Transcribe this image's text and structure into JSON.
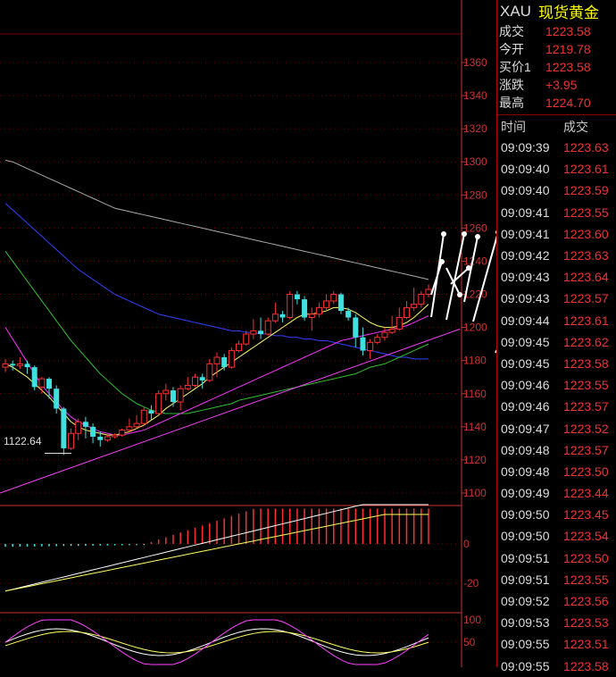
{
  "header": {
    "symbol": "XAU",
    "name": "现货黄金"
  },
  "quote": [
    {
      "label": "成交",
      "value": "1223.58"
    },
    {
      "label": "今开",
      "value": "1219.78"
    },
    {
      "label": "买价1",
      "value": "1223.58"
    },
    {
      "label": "涨跌",
      "value": "+3.95"
    },
    {
      "label": "最高",
      "value": "1224.70"
    }
  ],
  "ticks_header": {
    "time": "时间",
    "price": "成交"
  },
  "ticks": [
    {
      "time": "09:09:39",
      "price": "1223.63"
    },
    {
      "time": "09:09:40",
      "price": "1223.61"
    },
    {
      "time": "09:09:40",
      "price": "1223.59"
    },
    {
      "time": "09:09:41",
      "price": "1223.55"
    },
    {
      "time": "09:09:41",
      "price": "1223.60"
    },
    {
      "time": "09:09:42",
      "price": "1223.63"
    },
    {
      "time": "09:09:43",
      "price": "1223.64"
    },
    {
      "time": "09:09:43",
      "price": "1223.57"
    },
    {
      "time": "09:09:44",
      "price": "1223.61"
    },
    {
      "time": "09:09:45",
      "price": "1223.62"
    },
    {
      "time": "09:09:45",
      "price": "1223.58"
    },
    {
      "time": "09:09:46",
      "price": "1223.55"
    },
    {
      "time": "09:09:46",
      "price": "1223.57"
    },
    {
      "time": "09:09:47",
      "price": "1223.52"
    },
    {
      "time": "09:09:48",
      "price": "1223.57"
    },
    {
      "time": "09:09:48",
      "price": "1223.50"
    },
    {
      "time": "09:09:49",
      "price": "1223.44"
    },
    {
      "time": "09:09:50",
      "price": "1223.45"
    },
    {
      "time": "09:09:50",
      "price": "1223.54"
    },
    {
      "time": "09:09:51",
      "price": "1223.50"
    },
    {
      "time": "09:09:51",
      "price": "1223.55"
    },
    {
      "time": "09:09:52",
      "price": "1223.56"
    },
    {
      "time": "09:09:53",
      "price": "1223.53"
    },
    {
      "time": "09:09:55",
      "price": "1223.51"
    },
    {
      "time": "09:09:55",
      "price": "1223.58"
    }
  ],
  "colors": {
    "up": "#ff3030",
    "down": "#40e0e0",
    "grid": "#7a0000",
    "axis": "#c33333"
  },
  "chart_data": {
    "type": "candlestick",
    "price_axis": {
      "ticks": [
        1360,
        1340,
        1320,
        1300,
        1280,
        1260,
        1240,
        1220,
        1200,
        1180,
        1160,
        1140,
        1120,
        1100
      ]
    },
    "low_label": "1122.64",
    "macd_axis": {
      "ticks": [
        "0",
        "-20"
      ]
    },
    "kdj_axis": {
      "ticks": [
        "100",
        "50"
      ]
    },
    "candles": [
      {
        "o": 1176,
        "c": 1178,
        "h": 1181,
        "l": 1173
      },
      {
        "o": 1178,
        "c": 1177,
        "h": 1180,
        "l": 1174
      },
      {
        "o": 1177,
        "c": 1178,
        "h": 1182,
        "l": 1175
      },
      {
        "o": 1178,
        "c": 1176,
        "h": 1180,
        "l": 1172
      },
      {
        "o": 1176,
        "c": 1164,
        "h": 1177,
        "l": 1162
      },
      {
        "o": 1164,
        "c": 1169,
        "h": 1170,
        "l": 1160
      },
      {
        "o": 1169,
        "c": 1163,
        "h": 1170,
        "l": 1157
      },
      {
        "o": 1163,
        "c": 1151,
        "h": 1165,
        "l": 1148
      },
      {
        "o": 1151,
        "c": 1127,
        "h": 1152,
        "l": 1123
      },
      {
        "o": 1127,
        "c": 1136,
        "h": 1139,
        "l": 1126
      },
      {
        "o": 1136,
        "c": 1143,
        "h": 1145,
        "l": 1132
      },
      {
        "o": 1143,
        "c": 1140,
        "h": 1146,
        "l": 1133
      },
      {
        "o": 1140,
        "c": 1134,
        "h": 1142,
        "l": 1130
      },
      {
        "o": 1134,
        "c": 1132,
        "h": 1137,
        "l": 1128
      },
      {
        "o": 1132,
        "c": 1134,
        "h": 1135,
        "l": 1131
      },
      {
        "o": 1134,
        "c": 1135,
        "h": 1136,
        "l": 1133
      },
      {
        "o": 1135,
        "c": 1138,
        "h": 1139,
        "l": 1134
      },
      {
        "o": 1138,
        "c": 1140,
        "h": 1145,
        "l": 1137
      },
      {
        "o": 1140,
        "c": 1142,
        "h": 1147,
        "l": 1139
      },
      {
        "o": 1142,
        "c": 1150,
        "h": 1152,
        "l": 1141
      },
      {
        "o": 1150,
        "c": 1148,
        "h": 1153,
        "l": 1144
      },
      {
        "o": 1148,
        "c": 1160,
        "h": 1162,
        "l": 1147
      },
      {
        "o": 1160,
        "c": 1162,
        "h": 1166,
        "l": 1156
      },
      {
        "o": 1162,
        "c": 1155,
        "h": 1164,
        "l": 1152
      },
      {
        "o": 1155,
        "c": 1163,
        "h": 1165,
        "l": 1150
      },
      {
        "o": 1163,
        "c": 1165,
        "h": 1170,
        "l": 1162
      },
      {
        "o": 1165,
        "c": 1170,
        "h": 1172,
        "l": 1164
      },
      {
        "o": 1170,
        "c": 1168,
        "h": 1172,
        "l": 1163
      },
      {
        "o": 1168,
        "c": 1178,
        "h": 1181,
        "l": 1167
      },
      {
        "o": 1178,
        "c": 1182,
        "h": 1185,
        "l": 1170
      },
      {
        "o": 1182,
        "c": 1176,
        "h": 1184,
        "l": 1174
      },
      {
        "o": 1176,
        "c": 1186,
        "h": 1188,
        "l": 1175
      },
      {
        "o": 1186,
        "c": 1190,
        "h": 1192,
        "l": 1185
      },
      {
        "o": 1190,
        "c": 1196,
        "h": 1198,
        "l": 1189
      },
      {
        "o": 1196,
        "c": 1198,
        "h": 1205,
        "l": 1193
      },
      {
        "o": 1198,
        "c": 1196,
        "h": 1206,
        "l": 1193
      },
      {
        "o": 1196,
        "c": 1204,
        "h": 1206,
        "l": 1195
      },
      {
        "o": 1204,
        "c": 1208,
        "h": 1215,
        "l": 1203
      },
      {
        "o": 1208,
        "c": 1206,
        "h": 1210,
        "l": 1203
      },
      {
        "o": 1206,
        "c": 1220,
        "h": 1222,
        "l": 1205
      },
      {
        "o": 1220,
        "c": 1217,
        "h": 1222,
        "l": 1214
      },
      {
        "o": 1217,
        "c": 1206,
        "h": 1219,
        "l": 1204
      },
      {
        "o": 1206,
        "c": 1208,
        "h": 1212,
        "l": 1198
      },
      {
        "o": 1208,
        "c": 1212,
        "h": 1215,
        "l": 1206
      },
      {
        "o": 1212,
        "c": 1216,
        "h": 1220,
        "l": 1210
      },
      {
        "o": 1216,
        "c": 1220,
        "h": 1222,
        "l": 1214
      },
      {
        "o": 1220,
        "c": 1210,
        "h": 1221,
        "l": 1208
      },
      {
        "o": 1210,
        "c": 1206,
        "h": 1212,
        "l": 1204
      },
      {
        "o": 1206,
        "c": 1194,
        "h": 1208,
        "l": 1188
      },
      {
        "o": 1194,
        "c": 1186,
        "h": 1200,
        "l": 1183
      },
      {
        "o": 1186,
        "c": 1191,
        "h": 1193,
        "l": 1181
      },
      {
        "o": 1191,
        "c": 1194,
        "h": 1196,
        "l": 1190
      },
      {
        "o": 1194,
        "c": 1197,
        "h": 1200,
        "l": 1192
      },
      {
        "o": 1197,
        "c": 1199,
        "h": 1207,
        "l": 1196
      },
      {
        "o": 1199,
        "c": 1206,
        "h": 1212,
        "l": 1198
      },
      {
        "o": 1206,
        "c": 1212,
        "h": 1216,
        "l": 1205
      },
      {
        "o": 1212,
        "c": 1214,
        "h": 1224,
        "l": 1210
      },
      {
        "o": 1214,
        "c": 1220,
        "h": 1222,
        "l": 1212
      },
      {
        "o": 1220,
        "c": 1223,
        "h": 1226,
        "l": 1218
      }
    ],
    "ma_series": [
      {
        "color": "#aaaaaa",
        "values": [
          1301,
          1300,
          1298,
          1296,
          1294,
          1292,
          1290,
          1288,
          1286,
          1284,
          1282,
          1280,
          1278,
          1276,
          1274,
          1272,
          1271,
          1270,
          1269,
          1268,
          1267,
          1266,
          1265,
          1264,
          1263,
          1262,
          1261,
          1260,
          1259,
          1258,
          1257,
          1256,
          1255,
          1254,
          1253,
          1252,
          1251,
          1250,
          1249,
          1248,
          1247,
          1246,
          1245,
          1244,
          1243,
          1242,
          1241,
          1240,
          1239,
          1238,
          1237,
          1236,
          1235,
          1234,
          1233,
          1232,
          1231,
          1230,
          1229
        ]
      },
      {
        "color": "#3040ff",
        "values": [
          1275,
          1271,
          1267,
          1263,
          1259,
          1255,
          1251,
          1247,
          1243,
          1239,
          1235,
          1232,
          1229,
          1226,
          1223,
          1220,
          1218,
          1216,
          1214,
          1212,
          1210,
          1208,
          1207,
          1206,
          1205,
          1204,
          1203,
          1202,
          1201,
          1200,
          1199,
          1198,
          1198,
          1197,
          1197,
          1196,
          1196,
          1195,
          1195,
          1194,
          1194,
          1193,
          1193,
          1192,
          1192,
          1191,
          1190,
          1189,
          1188,
          1187,
          1186,
          1185,
          1184,
          1183,
          1182,
          1182,
          1181,
          1181,
          1181
        ]
      },
      {
        "color": "#30c030",
        "values": [
          1246,
          1240,
          1234,
          1228,
          1222,
          1216,
          1210,
          1204,
          1198,
          1192,
          1187,
          1182,
          1177,
          1172,
          1168,
          1164,
          1160,
          1157,
          1154,
          1152,
          1150,
          1149,
          1148,
          1148,
          1148,
          1148,
          1149,
          1150,
          1151,
          1152,
          1153,
          1154,
          1156,
          1157,
          1158,
          1159,
          1160,
          1161,
          1162,
          1163,
          1164,
          1165,
          1166,
          1167,
          1168,
          1169,
          1170,
          1171,
          1172,
          1174,
          1176,
          1177,
          1178,
          1180,
          1182,
          1184,
          1186,
          1188,
          1190
        ]
      },
      {
        "color": "#ff30ff",
        "values": [
          1200,
          1193,
          1186,
          1179,
          1172,
          1165,
          1160,
          1155,
          1150,
          1146,
          1143,
          1141,
          1139,
          1137,
          1136,
          1135,
          1135,
          1136,
          1137,
          1138,
          1140,
          1142,
          1144,
          1146,
          1148,
          1150,
          1152,
          1154,
          1156,
          1158,
          1160,
          1162,
          1164,
          1166,
          1168,
          1170,
          1172,
          1174,
          1176,
          1178,
          1180,
          1182,
          1184,
          1186,
          1188,
          1190,
          1192,
          1193,
          1194,
          1195,
          1196,
          1197,
          1198,
          1199,
          1200,
          1201,
          1203,
          1205,
          1207
        ]
      },
      {
        "color": "#ffff60",
        "values": [
          1178,
          1176,
          1173,
          1170,
          1166,
          1162,
          1158,
          1153,
          1148,
          1143,
          1140,
          1138,
          1137,
          1136,
          1135,
          1135,
          1136,
          1137,
          1139,
          1141,
          1144,
          1147,
          1151,
          1154,
          1157,
          1160,
          1163,
          1166,
          1170,
          1173,
          1176,
          1179,
          1182,
          1185,
          1188,
          1191,
          1194,
          1197,
          1200,
          1203,
          1206,
          1208,
          1208,
          1209,
          1210,
          1212,
          1212,
          1211,
          1209,
          1206,
          1203,
          1201,
          1200,
          1200,
          1201,
          1203,
          1206,
          1210,
          1214
        ]
      }
    ]
  }
}
